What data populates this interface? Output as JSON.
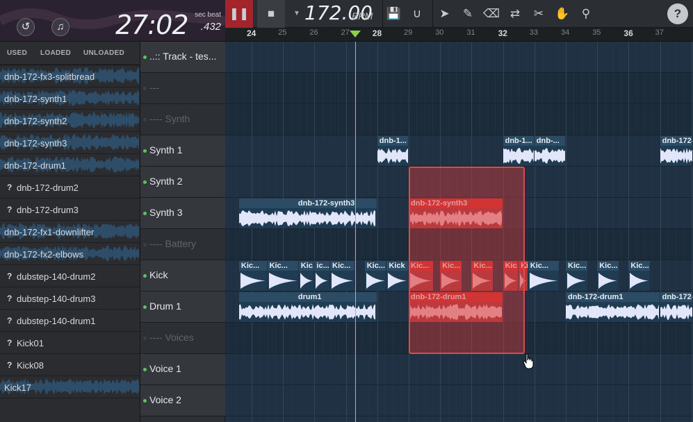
{
  "time": {
    "main": "27:02",
    "ms": ".432",
    "label": "sec beat"
  },
  "player_buttons": {
    "undo_icon": "undo-icon",
    "note_icon": "music-note-icon"
  },
  "toolbar": {
    "bpm_value": "172.00",
    "bpm_unit": "BPM",
    "icons": [
      "pause-icon",
      "stop-icon",
      "save-icon",
      "magnet-icon",
      "pointer-icon",
      "brush-icon",
      "eraser-icon",
      "swap-icon",
      "scissors-icon",
      "hand-icon",
      "search-icon",
      "help-icon"
    ],
    "help": "?"
  },
  "ruler": {
    "ticks": [
      "24",
      "25",
      "26",
      "27",
      "28",
      "29",
      "30",
      "31",
      "32",
      "33",
      "34",
      "35",
      "36",
      "37"
    ],
    "major": [
      "24",
      "28",
      "32",
      "36"
    ]
  },
  "sidebar": {
    "tabs": [
      "USED",
      "LOADED",
      "UNLOADED"
    ],
    "files": [
      {
        "name": "dnb-172-fx3-splitbread",
        "loaded": true
      },
      {
        "name": "dnb-172-synth1",
        "loaded": true
      },
      {
        "name": "dnb-172-synth2",
        "loaded": true
      },
      {
        "name": "dnb-172-synth3",
        "loaded": true
      },
      {
        "name": "dnb-172-drum1",
        "loaded": true
      },
      {
        "name": "dnb-172-drum2",
        "loaded": false
      },
      {
        "name": "dnb-172-drum3",
        "loaded": false
      },
      {
        "name": "dnb-172-fx1-downlifter",
        "loaded": true
      },
      {
        "name": "dnb-172-fx2-elbows",
        "loaded": true
      },
      {
        "name": "dubstep-140-drum2",
        "loaded": false
      },
      {
        "name": "dubstep-140-drum3",
        "loaded": false
      },
      {
        "name": "dubstep-140-drum1",
        "loaded": false
      },
      {
        "name": "Kick01",
        "loaded": false
      },
      {
        "name": "Kick08",
        "loaded": false
      },
      {
        "name": "Kick17",
        "loaded": true
      }
    ]
  },
  "tracks": [
    {
      "name": "..:: Track - tes...",
      "group": false
    },
    {
      "name": "---",
      "group": true
    },
    {
      "name": "---- Synth",
      "group": true
    },
    {
      "name": "Synth 1",
      "group": false
    },
    {
      "name": "Synth 2",
      "group": false
    },
    {
      "name": "Synth 3",
      "group": false
    },
    {
      "name": "---- Battery",
      "group": true
    },
    {
      "name": "Kick",
      "group": false
    },
    {
      "name": "Drum 1",
      "group": false
    },
    {
      "name": "---- Voices",
      "group": true
    },
    {
      "name": "Voice 1",
      "group": false
    },
    {
      "name": "Voice 2",
      "group": false
    }
  ],
  "clips": [
    {
      "track": 3,
      "start": 28.0,
      "end": 29.0,
      "label": "dnb-1...",
      "selected": false
    },
    {
      "track": 3,
      "start": 32.0,
      "end": 33.0,
      "label": "dnb-1...",
      "selected": false
    },
    {
      "track": 3,
      "start": 33.0,
      "end": 34.0,
      "label": "dnb-...",
      "selected": false
    },
    {
      "track": 3,
      "start": 37.0,
      "end": 38.2,
      "label": "dnb-172-",
      "selected": false
    },
    {
      "track": 5,
      "start": 23.6,
      "end": 28.0,
      "label": "dnb-172-synth3",
      "selected": false
    },
    {
      "track": 5,
      "start": 29.0,
      "end": 32.0,
      "label": "dnb-172-synth3",
      "selected": true
    },
    {
      "track": 7,
      "start": 23.6,
      "end": 24.5,
      "label": "Kic...",
      "selected": false
    },
    {
      "track": 7,
      "start": 24.5,
      "end": 25.5,
      "label": "Kic...",
      "selected": false
    },
    {
      "track": 7,
      "start": 25.5,
      "end": 26.0,
      "label": "Kic...",
      "selected": false
    },
    {
      "track": 7,
      "start": 26.0,
      "end": 26.5,
      "label": "ic...",
      "selected": false
    },
    {
      "track": 7,
      "start": 26.5,
      "end": 27.3,
      "label": "Kic...",
      "selected": false
    },
    {
      "track": 7,
      "start": 27.6,
      "end": 28.3,
      "label": "Kic...",
      "selected": false
    },
    {
      "track": 7,
      "start": 28.3,
      "end": 29.0,
      "label": "Kick",
      "selected": false
    },
    {
      "track": 7,
      "start": 29.0,
      "end": 29.8,
      "label": "Kic...",
      "selected": true
    },
    {
      "track": 7,
      "start": 30.0,
      "end": 30.7,
      "label": "Kic...",
      "selected": true
    },
    {
      "track": 7,
      "start": 31.0,
      "end": 31.7,
      "label": "Kic...",
      "selected": true
    },
    {
      "track": 7,
      "start": 32.0,
      "end": 32.5,
      "label": "Kic...",
      "selected": true
    },
    {
      "track": 7,
      "start": 32.5,
      "end": 32.8,
      "label": "Kic.",
      "selected": true
    },
    {
      "track": 7,
      "start": 32.8,
      "end": 33.8,
      "label": "Kic...",
      "selected": false
    },
    {
      "track": 7,
      "start": 34.0,
      "end": 34.7,
      "label": "Kic...",
      "selected": false
    },
    {
      "track": 7,
      "start": 35.0,
      "end": 35.7,
      "label": "Kic...",
      "selected": false
    },
    {
      "track": 7,
      "start": 36.0,
      "end": 36.7,
      "label": "Kic...",
      "selected": false
    },
    {
      "track": 8,
      "start": 23.6,
      "end": 28.0,
      "label": "drum1",
      "selected": false
    },
    {
      "track": 8,
      "start": 29.0,
      "end": 32.0,
      "label": "dnb-172-drum1",
      "selected": true
    },
    {
      "track": 8,
      "start": 34.0,
      "end": 37.0,
      "label": "dnb-172-drum1",
      "selected": false
    },
    {
      "track": 8,
      "start": 37.0,
      "end": 38.2,
      "label": "dnb-172-",
      "selected": false
    }
  ],
  "selection": {
    "start": 29.0,
    "end": 32.7,
    "track_from": 4,
    "track_to": 9
  },
  "playhead": 27.3
}
